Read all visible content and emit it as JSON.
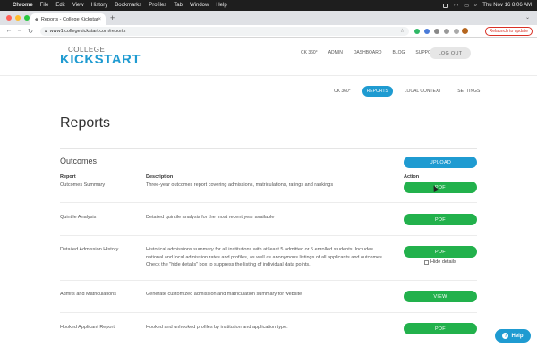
{
  "menubar": {
    "items": [
      "Chrome",
      "File",
      "Edit",
      "View",
      "History",
      "Bookmarks",
      "Profiles",
      "Tab",
      "Window",
      "Help"
    ],
    "datetime": "Thu Nov 16  8:06 AM"
  },
  "browser": {
    "tab_title": "Reports - College Kickstart",
    "url": "www1.collegekickstart.com/reports",
    "relaunch_label": "Relaunch to update"
  },
  "site": {
    "logo_line1": "COLLEGE",
    "logo_line2": "KICKSTART",
    "nav": [
      "CK 360°",
      "ADMIN",
      "DASHBOARD",
      "BLOG",
      "SUPPORT"
    ],
    "logout_label": "LOG OUT",
    "subnav": [
      "CK 360°",
      "REPORTS",
      "LOCAL CONTEXT",
      "SETTINGS"
    ],
    "subnav_active": "REPORTS"
  },
  "main": {
    "title": "Reports",
    "section": "Outcomes",
    "upload_label": "UPLOAD",
    "headers": {
      "report": "Report",
      "description": "Description",
      "action": "Action"
    },
    "rows": [
      {
        "report": "Outcomes Summary",
        "description": "Three-year outcomes report covering admissions, matriculations, ratings and rankings",
        "action": "PDF"
      },
      {
        "report": "Quintile Analysis",
        "description": "Detailed quintile analysis for the most recent year available",
        "action": "PDF"
      },
      {
        "report": "Detailed Admission History",
        "description": "Historical admissions summary for all institutions with at least 5 admitted or 5 enrolled students. Includes national and local admission rates and profiles, as well as anonymous listings of all applicants and outcomes. Check the \"hide details\" box to suppress the listing of individual data points.",
        "action": "PDF",
        "checkbox_label": "Hide details"
      },
      {
        "report": "Admits and Matriculations",
        "description": "Generate customized admission and matriculation summary for website",
        "action": "VIEW"
      },
      {
        "report": "Hooked Applicant Report",
        "description": "Hooked and unhooked profiles by institution and application type.",
        "action": "PDF"
      }
    ]
  },
  "help_label": "Help",
  "colors": {
    "brand_blue": "#1f9bd1",
    "action_green": "#22b14c"
  }
}
